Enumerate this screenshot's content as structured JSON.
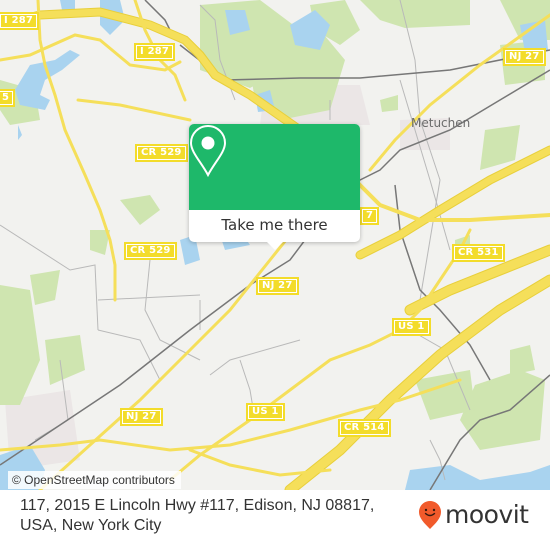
{
  "map": {
    "road_labels": [
      {
        "id": "i287-left",
        "text": "I 287"
      },
      {
        "id": "i287-center",
        "text": "I 287"
      },
      {
        "id": "nj27-top-right",
        "text": "NJ 27"
      },
      {
        "id": "cr529-upper",
        "text": "CR 529"
      },
      {
        "id": "cr529-lower",
        "text": "CR 529"
      },
      {
        "id": "nj27-center",
        "text": "NJ 27"
      },
      {
        "id": "cr531",
        "text": "CR 531"
      },
      {
        "id": "us1-right",
        "text": "US 1"
      },
      {
        "id": "us1-center",
        "text": "US 1"
      },
      {
        "id": "nj27-lower-left",
        "text": "NJ 27"
      },
      {
        "id": "cr514",
        "text": "CR 514"
      },
      {
        "id": "edge-left",
        "text": "5"
      },
      {
        "id": "edge-nj27",
        "text": "7"
      }
    ],
    "place_labels": [
      {
        "id": "metuchen",
        "text": "Metuchen"
      }
    ],
    "colors": {
      "background": "#f2f2ef",
      "park": "#cfe5b0",
      "water": "#a9d3ef",
      "highway": "#f5df5a",
      "highway_casing": "#e8cf3a",
      "minor_road": "#b9b9b9",
      "rail": "#777777",
      "industrial": "#ebe6e6"
    },
    "attribution": "© OpenStreetMap contributors"
  },
  "popup": {
    "icon": "map-pin-icon",
    "button_label": "Take me there",
    "accent": "#1eb86a"
  },
  "footer": {
    "address": "117, 2015 E Lincoln Hwy #117, Edison, NJ 08817, USA, New York City",
    "brand": "moovit",
    "brand_icon": "moovit-pin-smile-icon",
    "brand_color": "#f15a2b"
  }
}
